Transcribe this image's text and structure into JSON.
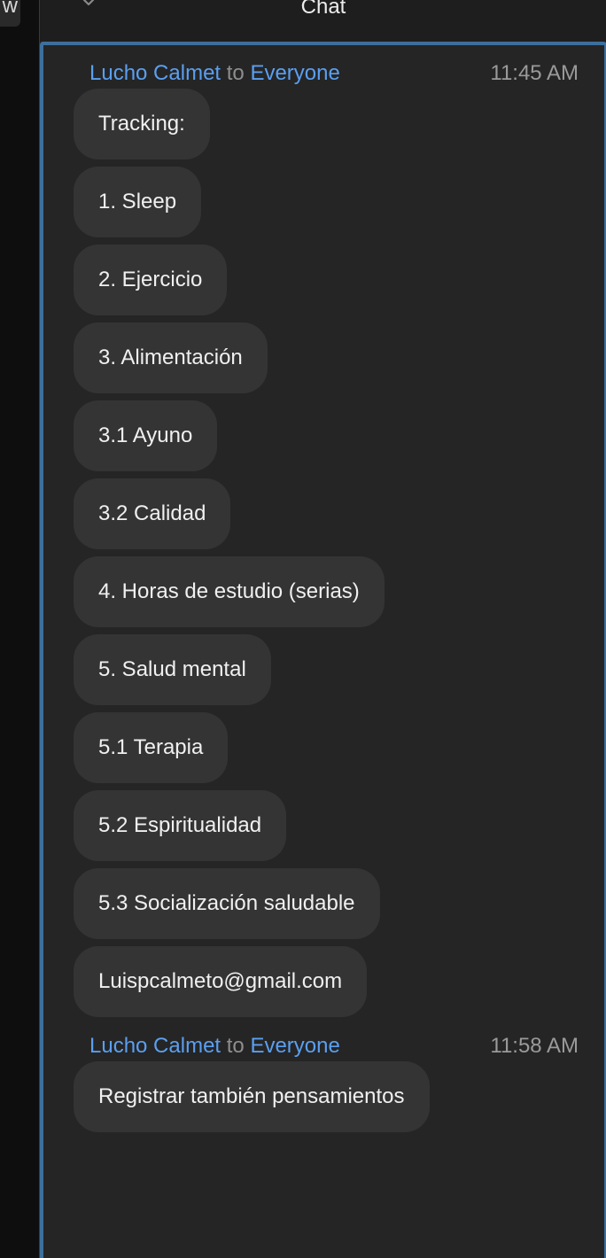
{
  "left_panel": {
    "tab_label": "w"
  },
  "panel": {
    "title": "Chat"
  },
  "messages": [
    {
      "sender": "Lucho Calmet",
      "to_word": "to",
      "recipient": "Everyone",
      "time": "11:45 AM",
      "lines": [
        "Tracking:",
        "1. Sleep",
        "2. Ejercicio",
        "3. Alimentación",
        "3.1 Ayuno",
        "3.2 Calidad",
        "4. Horas de estudio (serias)",
        "5. Salud mental",
        "5.1 Terapia",
        "5.2 Espiritualidad",
        "5.3 Socialización saludable",
        "Luispcalmeto@gmail.com"
      ]
    },
    {
      "sender": "Lucho Calmet",
      "to_word": "to",
      "recipient": "Everyone",
      "time": "11:58 AM",
      "lines": [
        "Registrar también pensamientos"
      ]
    }
  ]
}
